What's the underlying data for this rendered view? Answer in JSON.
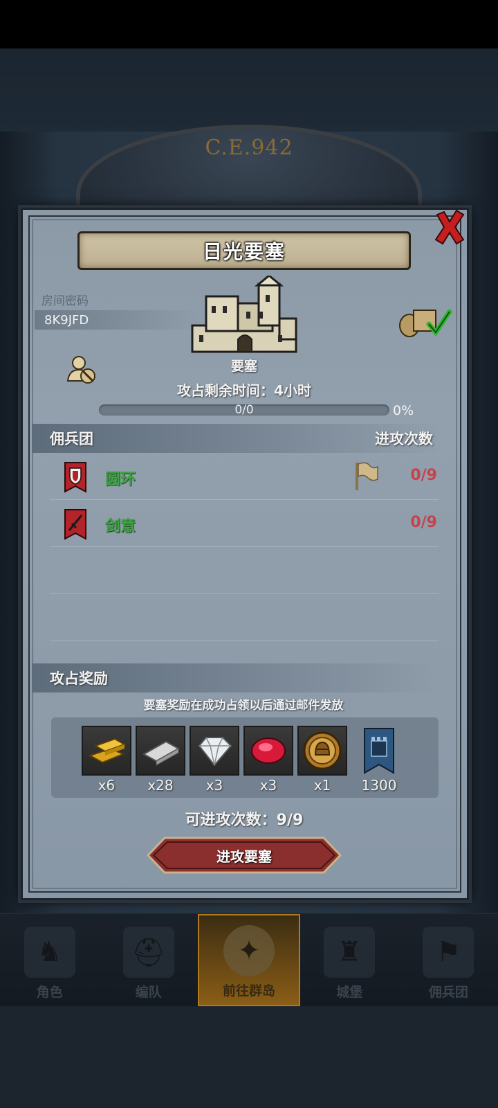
{
  "scene": {
    "year": "C.E.942"
  },
  "dialog": {
    "title": "日光要塞",
    "room_label": "房间密码",
    "room_code": "8K9JFD",
    "building_label": "要塞",
    "time_remaining": "攻占剩余时间：4小时",
    "progress": {
      "text": "0/0",
      "percent_text": "0%",
      "fill_fraction": 0
    },
    "mercenary_header": "佣兵团",
    "attack_count_header": "进攻次数",
    "mercenaries": [
      {
        "name": "圆环",
        "count": "0/9",
        "badge": "shield-badge-icon",
        "has_flag": true
      },
      {
        "name": "剑意",
        "count": "0/9",
        "badge": "sword-badge-icon",
        "has_flag": false
      }
    ],
    "reward_header": "攻占奖励",
    "reward_note": "要塞奖励在成功占领以后通过邮件发放",
    "rewards": [
      {
        "icon": "gold-bar-icon",
        "qty": "x6"
      },
      {
        "icon": "iron-bar-icon",
        "qty": "x28"
      },
      {
        "icon": "diamond-icon",
        "qty": "x3"
      },
      {
        "icon": "ruby-icon",
        "qty": "x3"
      },
      {
        "icon": "helmet-medal-icon",
        "qty": "x1"
      },
      {
        "icon": "castle-banner-icon",
        "qty": "1300"
      }
    ],
    "attempts": "可进攻次数：9/9",
    "attack_button": "进攻要塞"
  },
  "bottom_nav": [
    {
      "label": "角色",
      "icon": "knight-icon",
      "active": false
    },
    {
      "label": "编队",
      "icon": "helmet-icon",
      "active": false
    },
    {
      "label": "前往群岛",
      "icon": "island-compass-icon",
      "active": true
    },
    {
      "label": "城堡",
      "icon": "castle-icon",
      "active": false
    },
    {
      "label": "佣兵团",
      "icon": "mercenary-banner-icon",
      "active": false
    }
  ],
  "colors": {
    "mercenary_name": "#3fa444",
    "attack_count": "#c9414a",
    "attack_button": "#8a2e2e"
  }
}
